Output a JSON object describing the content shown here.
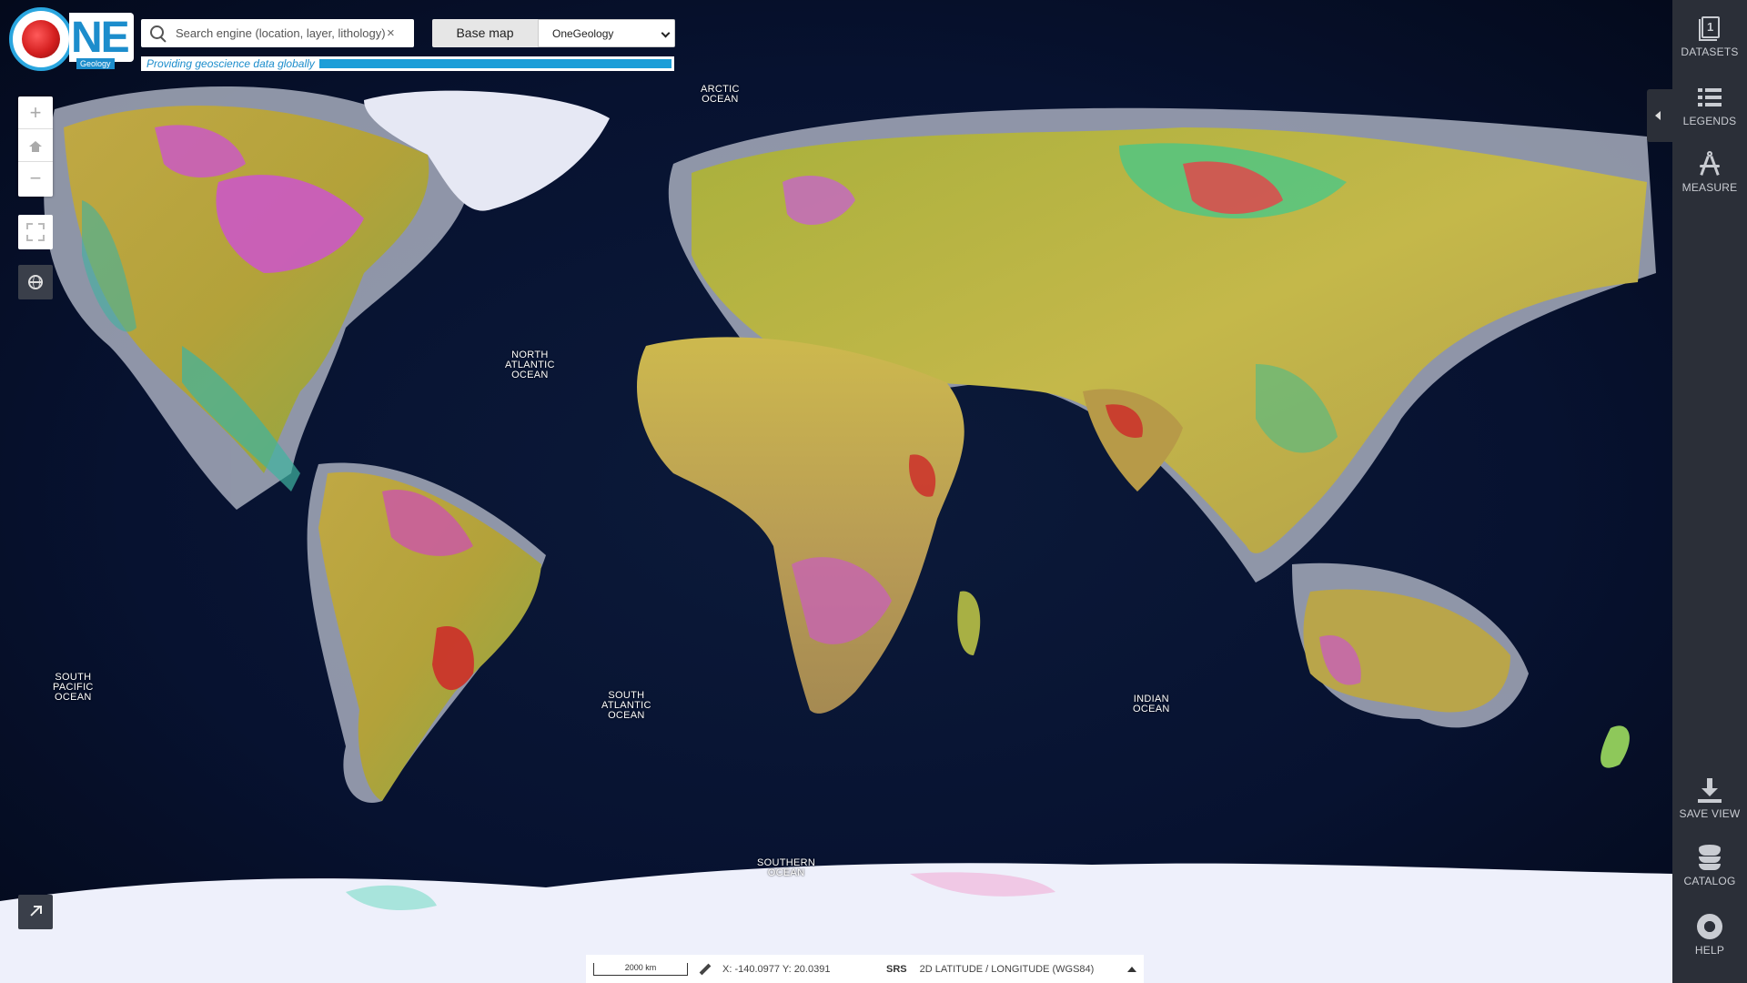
{
  "app": {
    "logo_text": "NE",
    "logo_sub": "Geology",
    "tagline": "Providing geoscience data globally"
  },
  "search": {
    "placeholder": "Search engine (location, layer, lithology)",
    "clear_icon": "close-icon"
  },
  "basemap": {
    "label": "Base map",
    "selected": "OneGeology"
  },
  "map_controls": {
    "zoom_in": "+",
    "zoom_out": "−"
  },
  "ocean_labels": [
    "ARCTIC\nOCEAN",
    "NORTH\nATLANTIC\nOCEAN",
    "SOUTH\nPACIFIC\nOCEAN",
    "SOUTH\nATLANTIC\nOCEAN",
    "INDIAN\nOCEAN",
    "SOUTHERN\nOCEAN"
  ],
  "sidebar": {
    "top_items": [
      {
        "label": "DATASETS",
        "icon": "datasets-icon",
        "badge": "1"
      },
      {
        "label": "LEGENDS",
        "icon": "list-icon"
      },
      {
        "label": "MEASURE",
        "icon": "compass-icon"
      }
    ],
    "bottom_items": [
      {
        "label": "SAVE VIEW",
        "icon": "download-icon"
      },
      {
        "label": "CATALOG",
        "icon": "database-icon"
      },
      {
        "label": "HELP",
        "icon": "lifebuoy-icon"
      }
    ]
  },
  "status": {
    "scale": "2000 km",
    "coordinates": "X: -140.0977 Y: 20.0391",
    "srs_label": "SRS",
    "srs_value": "2D LATITUDE / LONGITUDE (WGS84)"
  },
  "colors": {
    "brand_blue": "#1c8dcc",
    "sidebar_bg": "#2b2f38",
    "ocean": "#0a1834",
    "shelf": "#a7adbd"
  }
}
